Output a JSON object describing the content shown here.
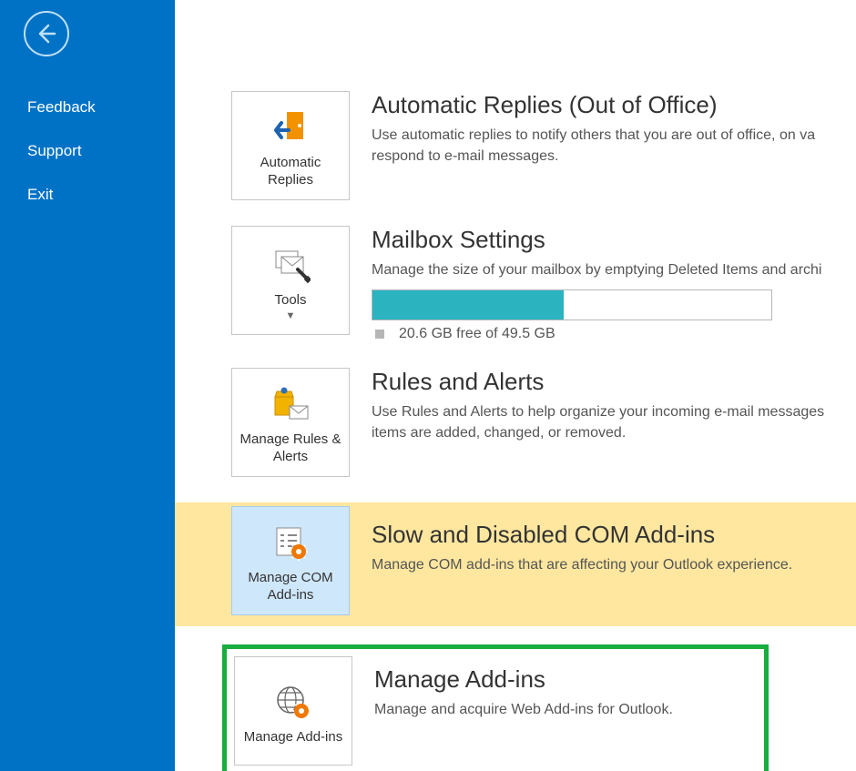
{
  "sidebar": {
    "feedback": "Feedback",
    "support": "Support",
    "exit": "Exit"
  },
  "persona_fragment": "",
  "sections": {
    "autoreply": {
      "card_label": "Automatic Replies",
      "title": "Automatic Replies (Out of Office)",
      "text": "Use automatic replies to notify others that you are out of office, on va   respond to e-mail messages."
    },
    "tools": {
      "card_label": "Tools",
      "title": "Mailbox Settings",
      "text": "Manage the size of your mailbox by emptying Deleted Items and archi",
      "storage_line": "20.6 GB free of 49.5 GB",
      "progress_pct": 48
    },
    "rules": {
      "card_label": "Manage Rules & Alerts",
      "title": "Rules and Alerts",
      "text": "Use Rules and Alerts to help organize your incoming e-mail messages  items are added, changed, or removed."
    },
    "com": {
      "card_label": "Manage COM Add-ins",
      "title": "Slow and Disabled COM Add-ins",
      "text": "Manage COM add-ins that are affecting your Outlook experience."
    },
    "web": {
      "card_label": "Manage Add-ins",
      "title": "Manage Add-ins",
      "text": "Manage and acquire Web Add-ins for Outlook."
    }
  }
}
